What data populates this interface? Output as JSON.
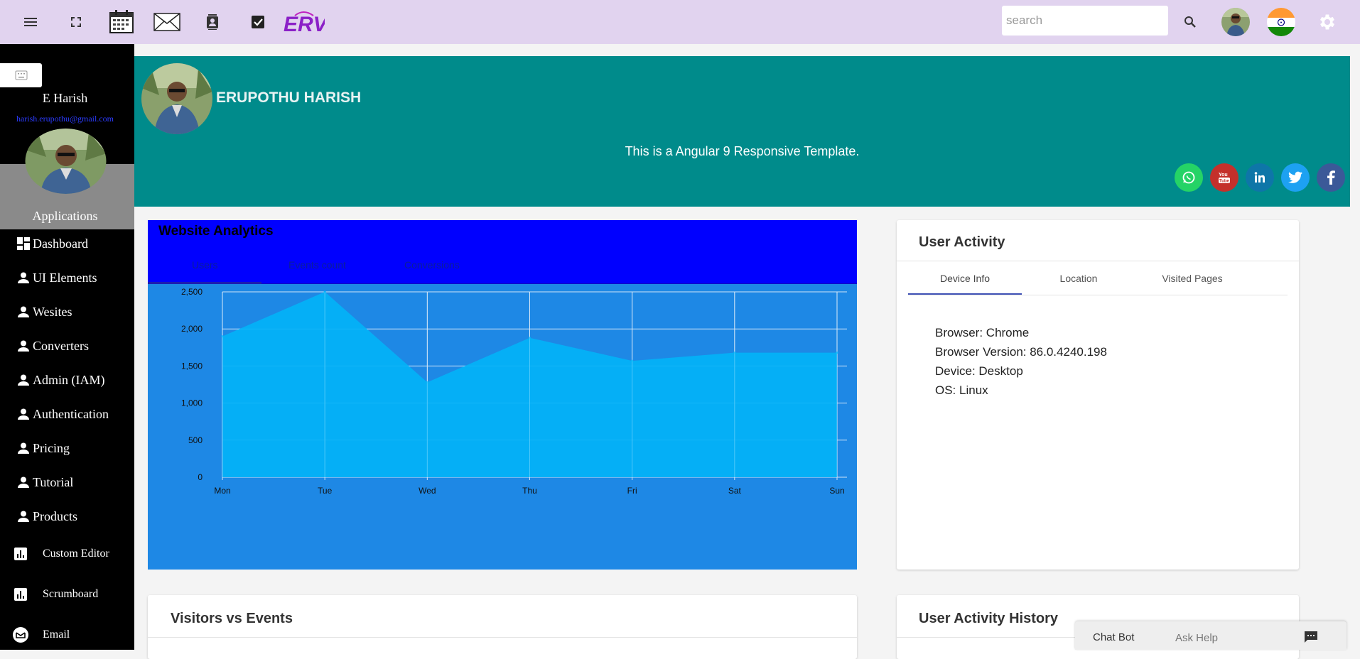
{
  "topbar": {
    "icons": [
      "menu-icon",
      "fullscreen-icon",
      "calendar-icon",
      "mail-icon",
      "contacts-icon",
      "tasks-icon"
    ],
    "logo_text": "ERV",
    "search_placeholder": "search",
    "search_value": ""
  },
  "sidebar": {
    "user_name": "E Harish",
    "user_email": "harish.erupothu@gmail.com",
    "section_label": "Applications",
    "items": [
      {
        "label": "Dashboard",
        "icon": "dashboard-icon"
      },
      {
        "label": "UI Elements",
        "icon": "person-icon"
      },
      {
        "label": "Wesites",
        "icon": "person-icon"
      },
      {
        "label": "Converters",
        "icon": "person-icon"
      },
      {
        "label": "Admin (IAM)",
        "icon": "person-icon"
      },
      {
        "label": "Authentication",
        "icon": "person-icon"
      },
      {
        "label": "Pricing",
        "icon": "person-icon"
      },
      {
        "label": "Tutorial",
        "icon": "person-icon"
      },
      {
        "label": "Products",
        "icon": "person-icon"
      }
    ],
    "items2": [
      {
        "label": "Custom Editor",
        "icon": "bar-chart-icon"
      },
      {
        "label": "Scrumboard",
        "icon": "bar-chart-icon"
      },
      {
        "label": "Email",
        "icon": "email-icon"
      }
    ]
  },
  "banner": {
    "name": "ERUPOTHU HARISH",
    "tagline": "This is a Angular 9 Responsive Template.",
    "social": [
      {
        "name": "whatsapp",
        "color": "#25d366"
      },
      {
        "name": "youtube",
        "color": "#c4302b"
      },
      {
        "name": "linkedin",
        "color": "#0e76a8"
      },
      {
        "name": "twitter",
        "color": "#1da1f2"
      },
      {
        "name": "facebook",
        "color": "#3b5998"
      }
    ]
  },
  "analytics": {
    "title": "Website Analytics",
    "tabs": [
      "Users",
      "Events count",
      "Conversions"
    ],
    "active_tab": 0
  },
  "chart_data": {
    "type": "area",
    "categories": [
      "Mon",
      "Tue",
      "Wed",
      "Thu",
      "Fri",
      "Sat",
      "Sun"
    ],
    "series": [
      {
        "values": [
          1900,
          2500,
          1280,
          1880,
          1570,
          1680,
          1680
        ]
      }
    ],
    "ylim": [
      0,
      2500
    ],
    "yticks": [
      0,
      500,
      1000,
      1500,
      2000,
      2500
    ],
    "ytick_labels": [
      "0",
      "500",
      "1,000",
      "1,500",
      "2,000",
      "2,500"
    ],
    "grid": true,
    "colors": {
      "fill": "#03b2f7",
      "background": "#1e88e5",
      "grid": "#d0e4f7"
    }
  },
  "user_activity": {
    "title": "User Activity",
    "tabs": [
      "Device Info",
      "Location",
      "Visited Pages"
    ],
    "active_tab": 0,
    "lines": [
      "Browser: Chrome",
      "Browser Version: 86.0.4240.198",
      "Device: Desktop",
      "OS: Linux"
    ]
  },
  "visitors_events": {
    "title": "Visitors vs Events"
  },
  "user_activity_history": {
    "title": "User Activity History"
  },
  "chatbot": {
    "title": "Chat Bot",
    "help": "Ask Help",
    "icon": "chat-icon"
  }
}
